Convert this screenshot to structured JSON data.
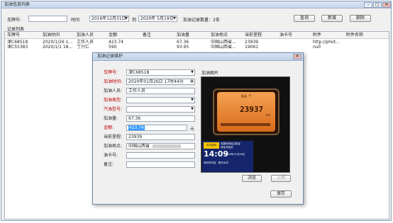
{
  "window": {
    "title": "加油信息列表",
    "minimize_glyph": "–",
    "maximize_glyph": "□",
    "close_glyph": "✕"
  },
  "filter": {
    "plate_label": "车牌号:",
    "plate_value": "",
    "time_label": "时间",
    "date_from": "2016年12月31日",
    "to_label": "到",
    "date_to": "2020年 5月19日",
    "count_text": "加油记录数量：2条",
    "query_button": "查询",
    "add_button": "新增",
    "delete_button": "删除"
  },
  "list": {
    "title": "记录列表",
    "columns": [
      "车牌号",
      "加油时间",
      "加油人员",
      "金额",
      "备注",
      "加油量",
      "加油地点",
      "当前里程",
      "油卡号",
      "附件",
      "附件名称"
    ],
    "rows": [
      [
        "津C68518",
        "2020/1/26 1...",
        "工作人员",
        "423.74",
        "",
        "67.36",
        "中国山西省...",
        "23939",
        "",
        "http://phot...",
        ""
      ],
      [
        "津C55383",
        "2020/1/1 18...",
        "丁兴仁",
        "590",
        "",
        "93.95",
        "中国山西省...",
        "19061",
        "",
        "null",
        ""
      ]
    ]
  },
  "dialog": {
    "title": "加油记录维护",
    "close_glyph": "✕",
    "fields": {
      "plate": {
        "label": "车牌号:",
        "value": "津C68518"
      },
      "time": {
        "label": "加油时间:",
        "value": "2020年01月26日 17时44分"
      },
      "person": {
        "label": "加油人员:",
        "value": "工作人员"
      },
      "fuel_type": {
        "label": "加油类型:",
        "value": ""
      },
      "vehicle_model": {
        "label": "汽油型号:",
        "value": ""
      },
      "volume": {
        "label": "加油量:",
        "value": "67.36"
      },
      "amount": {
        "label": "金额:",
        "value": "423.74",
        "unit": "元"
      },
      "mileage": {
        "label": "当前里程:",
        "value": "23939"
      },
      "location": {
        "label": "加油地点:",
        "value": "中国山西省"
      },
      "card": {
        "label": "油卡号:",
        "value": ""
      },
      "remark": {
        "label": "备注:",
        "value": ""
      }
    },
    "photo_label": "加油图片",
    "photo": {
      "gauge_reading": "64",
      "gauge_unit": "°F",
      "odometer": "23937",
      "odo_unit": "km",
      "stamp_badge": "水印相机",
      "stamp_line1": "拍摄时间经过验证",
      "stamp_line2": "地址未验证",
      "stamp_time": "14:09",
      "stamp_date": "2020年01月26日",
      "stamp_addr": "郑州市内容 · 数字水印"
    },
    "browse_button": "浏览",
    "upload_button": "上传",
    "save_button": "保存"
  },
  "colors": {
    "required_label": "#c00000",
    "selection": "#3399ff",
    "gauge_orange": "#f08a24"
  }
}
